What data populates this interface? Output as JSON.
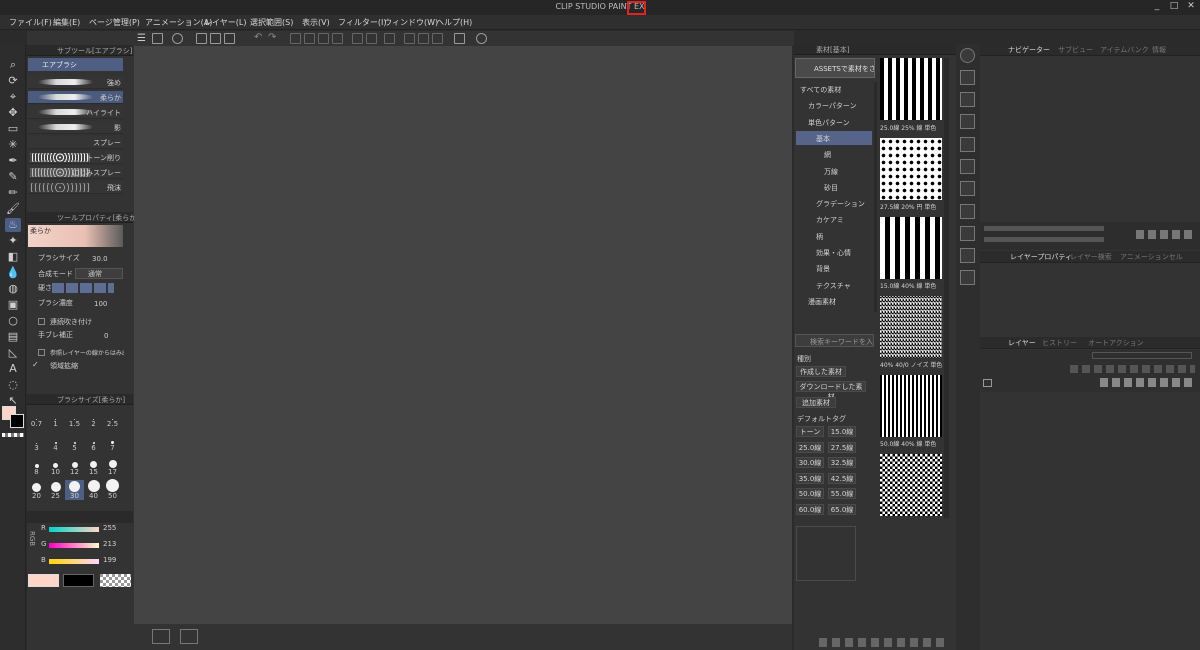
{
  "title_bar": {
    "title": "CLIP STUDIO PAINT EX",
    "highlight_color": "#e32222",
    "window_buttons": [
      "_",
      "□",
      "✕"
    ]
  },
  "menu": [
    "ファイル(F)",
    "編集(E)",
    "ページ管理(P)",
    "アニメーション(A)",
    "レイヤー(L)",
    "選択範囲(S)",
    "表示(V)",
    "フィルター(I)",
    "ウィンドウ(W)",
    "ヘルプ(H)"
  ],
  "subtool_panel": {
    "header": "サブツール[エアブラシ]",
    "group": "エアブラシ",
    "items": [
      "強め",
      "柔らか",
      "ハイライト",
      "影",
      "スプレー",
      "トーン削り",
      "にじみスプレー",
      "飛沫"
    ],
    "selected": "柔らか"
  },
  "tool_property": {
    "header": "ツールプロパティ[柔らか]",
    "preview_label": "柔らか",
    "brush_size_label": "ブラシサイズ",
    "brush_size_value": "30.0",
    "blend_label": "合成モード",
    "blend_value": "通常",
    "hardness_label": "硬さ",
    "density_label": "ブラシ濃度",
    "density_value": "100",
    "continuous_label": "連続吹き付け",
    "stabilize_label": "手ブレ補正",
    "stabilize_value": "0",
    "refer_label": "参照レイヤーの線からはみ出さない",
    "fill_label": "領域拡縮"
  },
  "brush_size_panel": {
    "header": "ブラシサイズ[柔らか]",
    "sizes": [
      "0.7",
      "1",
      "1.5",
      "2",
      "2.5",
      "3",
      "4",
      "5",
      "6",
      "7",
      "8",
      "10",
      "12",
      "15",
      "17",
      "20",
      "25",
      "30",
      "40",
      "50"
    ]
  },
  "color_slider": {
    "mode": "RGB",
    "r_label": "R",
    "r": "255",
    "g_label": "G",
    "g": "213",
    "b_label": "B",
    "b": "199",
    "main_color": "#ffd5c7",
    "sub_color": "#000000"
  },
  "material_panel": {
    "header": "素材[基本]",
    "assets_button": "ASSETSで素材をさがす",
    "tree": [
      "すべての素材",
      "カラーパターン",
      "単色パターン",
      "基本",
      "網",
      "万線",
      "砂目",
      "グラデーション",
      "カケアミ",
      "柄",
      "効果・心情",
      "背景",
      "テクスチャ",
      "漫画素材"
    ],
    "selected": "基本",
    "search_placeholder": "検索キーワードを入",
    "kind_label": "種別",
    "kind_buttons": [
      "作成した素材",
      "ダウンロードした素材",
      "追加素材"
    ],
    "default_tag_label": "デフォルトタグ",
    "tags": [
      "トーン",
      "15.0線",
      "25.0線",
      "27.5線",
      "30.0線",
      "32.5線",
      "35.0線",
      "42.5線",
      "50.0線",
      "55.0線",
      "60.0線",
      "65.0線"
    ],
    "thumb_captions": [
      "25.0線 25% 線 単色",
      "27.5線 20% 円 単色",
      "15.0線 40% 線 単色",
      "40% 40/0 ノイズ 単色",
      "50.0線 40% 線 単色"
    ]
  },
  "right_panels": {
    "navigator_tabs": [
      "ナビゲーター",
      "サブビュー",
      "アイテムバンク",
      "情報"
    ],
    "layer_property_tabs": [
      "レイヤープロパティ",
      "レイヤー検索",
      "アニメーションセル"
    ],
    "layer_tabs": [
      "レイヤー",
      "ヒストリー",
      "オートアクション"
    ]
  }
}
